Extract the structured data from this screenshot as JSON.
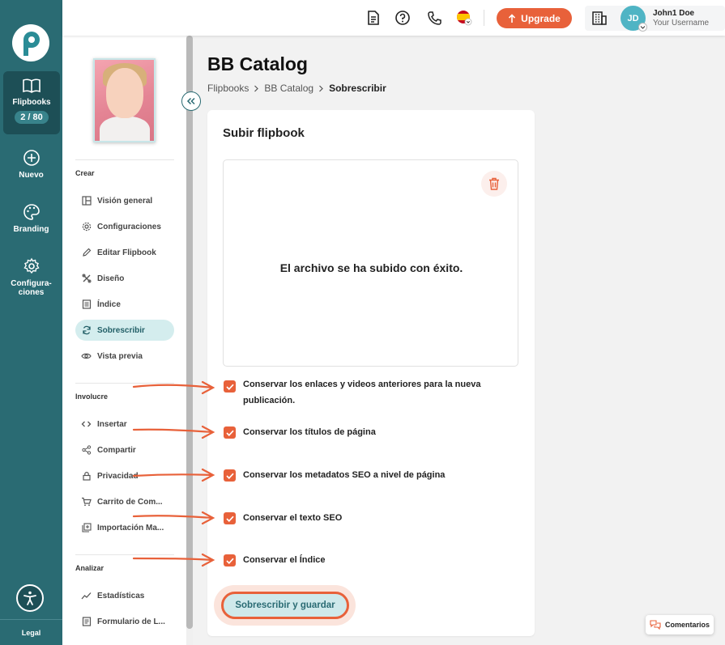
{
  "rail": {
    "flipbooks_label": "Flipbooks",
    "flipbooks_count": "2 / 80",
    "nuevo_label": "Nuevo",
    "branding_label": "Branding",
    "config_line1": "Configura-",
    "config_line2": "ciones",
    "legal_label": "Legal"
  },
  "topbar": {
    "upgrade_label": "Upgrade",
    "avatar_initials": "JD",
    "user_name": "John1 Doe",
    "user_subtitle": "Your Username"
  },
  "sidebar": {
    "sections": {
      "crear": "Crear",
      "involucre": "Involucre",
      "analizar": "Analizar"
    },
    "items": {
      "vision": "Visión general",
      "configuraciones": "Configuraciones",
      "editar": "Editar Flipbook",
      "diseno": "Diseño",
      "indice": "Índice",
      "sobrescribir": "Sobrescribir",
      "vista_previa": "Vista previa",
      "insertar": "Insertar",
      "compartir": "Compartir",
      "privacidad": "Privacidad",
      "carrito": "Carrito de Com...",
      "importacion": "Importación Ma...",
      "estadisticas": "Estadísticas",
      "formulario": "Formulario de L..."
    }
  },
  "main": {
    "title": "BB Catalog",
    "breadcrumb": {
      "crumb1": "Flipbooks",
      "crumb2": "BB Catalog",
      "current": "Sobrescribir"
    },
    "card": {
      "title": "Subir flipbook",
      "upload_message": "El archivo se ha subido con éxito.",
      "options": {
        "links_line1": "Conservar los enlaces y videos anteriores para la nueva",
        "links_line2": "publicación.",
        "titles": "Conservar los títulos de página",
        "seo_meta": "Conservar los metadatos SEO a nivel de página",
        "seo_text": "Conservar el texto SEO",
        "index": "Conservar el Índice"
      },
      "save_label": "Sobrescribir y guardar"
    }
  },
  "feedback_label": "Comentarios",
  "colors": {
    "rail": "#2a6b73",
    "accent": "#e8613a",
    "active_nav": "#d4edee"
  }
}
